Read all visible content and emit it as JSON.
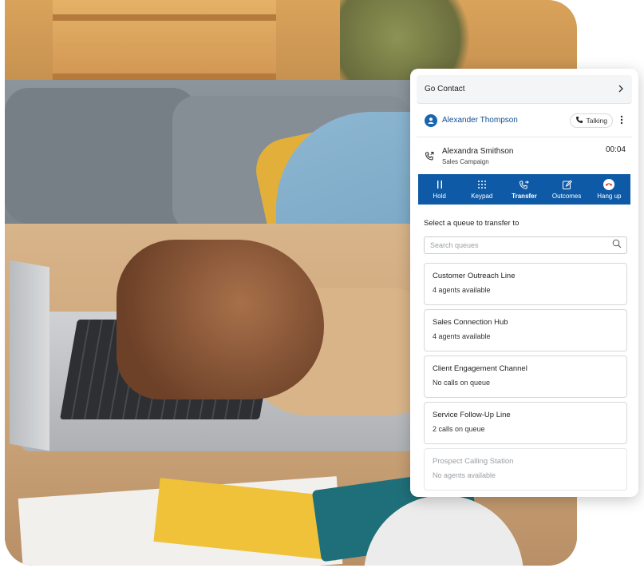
{
  "panel": {
    "go_contact": "Go Contact",
    "caller": {
      "name": "Alexander Thompson",
      "status": "Talking"
    },
    "call": {
      "name": "Alexandra Smithson",
      "campaign": "Sales Campaign",
      "timer": "00:04"
    },
    "toolbar": [
      {
        "label": "Hold",
        "icon": "pause-icon"
      },
      {
        "label": "Keypad",
        "icon": "keypad-icon"
      },
      {
        "label": "Transfer",
        "icon": "transfer-phone-icon",
        "active": true
      },
      {
        "label": "Outcomes",
        "icon": "edit-note-icon"
      },
      {
        "label": "Hang up",
        "icon": "hang-up-icon"
      }
    ],
    "transfer_title": "Select a queue to transfer to",
    "search_placeholder": "Search queues",
    "queues": [
      {
        "name": "Customer Outreach Line",
        "status": "4 agents available",
        "enabled": true
      },
      {
        "name": "Sales Connection Hub",
        "status": "4 agents available",
        "enabled": true
      },
      {
        "name": "Client Engagement Channel",
        "status": "No calls on queue",
        "enabled": true
      },
      {
        "name": "Service Follow-Up Line",
        "status": "2 calls on queue",
        "enabled": true
      },
      {
        "name": "Prospect Calling Station",
        "status": "No agents available",
        "enabled": false
      }
    ]
  },
  "colors": {
    "toolbar_bg": "#0f5aa6",
    "link_blue": "#124f92",
    "hangup_red": "#d62b2b"
  }
}
